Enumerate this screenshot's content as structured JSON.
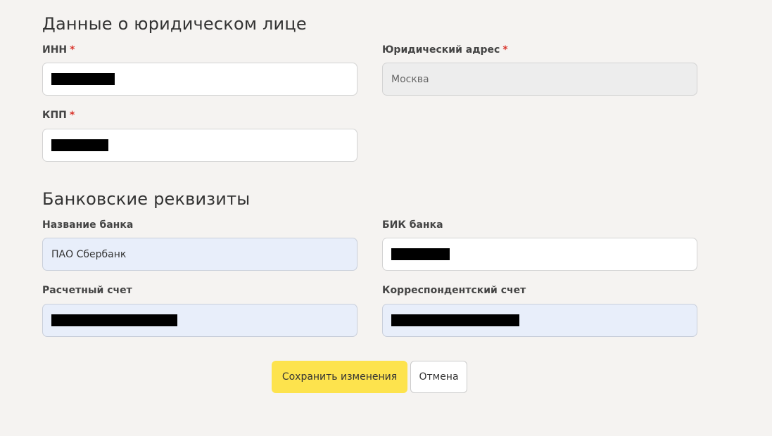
{
  "legal_entity": {
    "title": "Данные о юридическом лице",
    "inn": {
      "label": "ИНН",
      "required_mark": "*"
    },
    "legal_address": {
      "label": "Юридический адрес",
      "required_mark": "*",
      "value": "Москва"
    },
    "kpp": {
      "label": "КПП",
      "required_mark": "*"
    }
  },
  "bank": {
    "title": "Банковские реквизиты",
    "bank_name": {
      "label": "Название банка",
      "value": "ПАО Сбербанк"
    },
    "bik": {
      "label": "БИК банка"
    },
    "account": {
      "label": "Расчетный счет"
    },
    "corr_account": {
      "label": "Корреспондентский счет"
    }
  },
  "actions": {
    "save_label": "Сохранить изменения",
    "cancel_label": "Отмена",
    "save_color": "#fde34d"
  }
}
